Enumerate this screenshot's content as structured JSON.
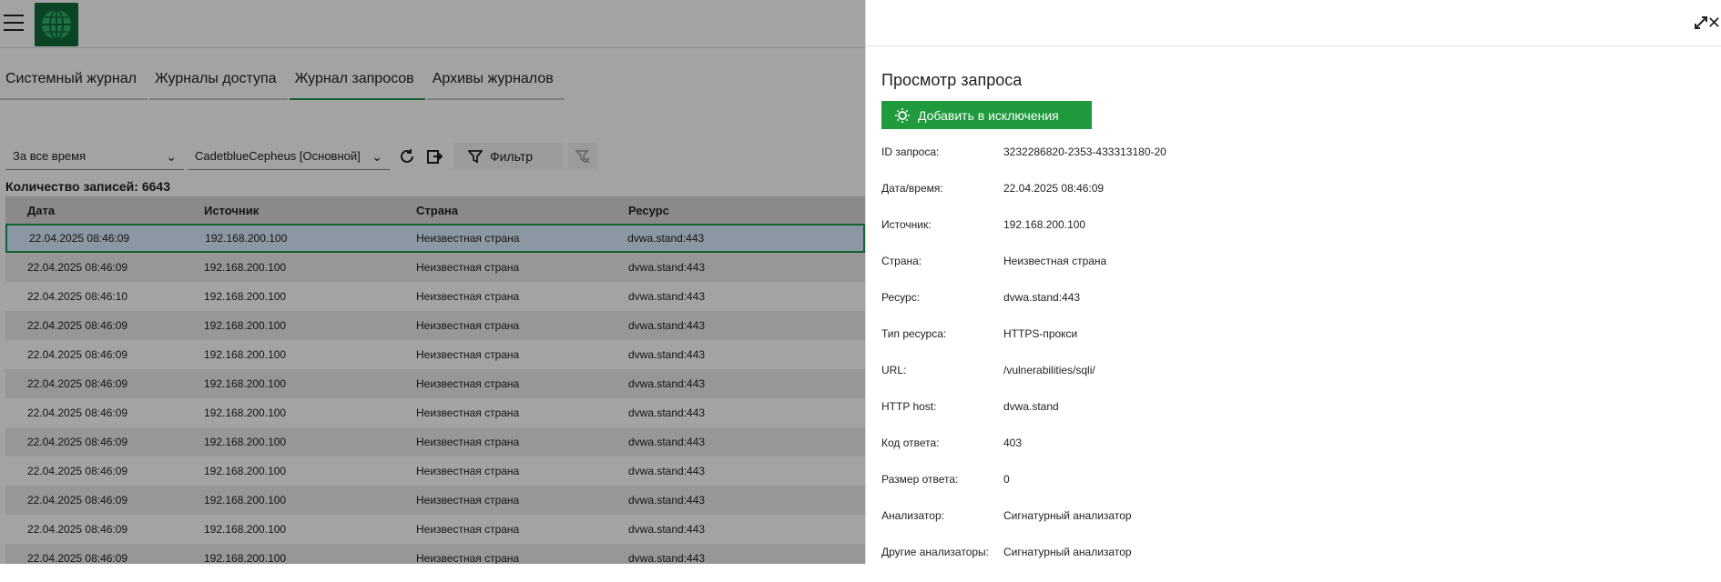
{
  "left": {
    "tabs": [
      {
        "label": "Системный журнал",
        "active": false
      },
      {
        "label": "Журналы доступа",
        "active": false
      },
      {
        "label": "Журнал запросов",
        "active": true
      },
      {
        "label": "Архивы журналов",
        "active": false
      }
    ],
    "filters": {
      "period": "За все время",
      "node": "CadetblueCepheus [Основной]",
      "filter_label": "Фильтр"
    },
    "count_label": "Количество записей: 6643",
    "table": {
      "headers": [
        "Дата",
        "Источник",
        "Страна",
        "Ресурс"
      ],
      "rows": [
        {
          "date": "22.04.2025 08:46:09",
          "source": "192.168.200.100",
          "country": "Неизвестная страна",
          "resource": "dvwa.stand:443",
          "selected": true
        },
        {
          "date": "22.04.2025 08:46:09",
          "source": "192.168.200.100",
          "country": "Неизвестная страна",
          "resource": "dvwa.stand:443"
        },
        {
          "date": "22.04.2025 08:46:10",
          "source": "192.168.200.100",
          "country": "Неизвестная страна",
          "resource": "dvwa.stand:443"
        },
        {
          "date": "22.04.2025 08:46:09",
          "source": "192.168.200.100",
          "country": "Неизвестная страна",
          "resource": "dvwa.stand:443"
        },
        {
          "date": "22.04.2025 08:46:09",
          "source": "192.168.200.100",
          "country": "Неизвестная страна",
          "resource": "dvwa.stand:443"
        },
        {
          "date": "22.04.2025 08:46:09",
          "source": "192.168.200.100",
          "country": "Неизвестная страна",
          "resource": "dvwa.stand:443"
        },
        {
          "date": "22.04.2025 08:46:09",
          "source": "192.168.200.100",
          "country": "Неизвестная страна",
          "resource": "dvwa.stand:443"
        },
        {
          "date": "22.04.2025 08:46:09",
          "source": "192.168.200.100",
          "country": "Неизвестная страна",
          "resource": "dvwa.stand:443"
        },
        {
          "date": "22.04.2025 08:46:09",
          "source": "192.168.200.100",
          "country": "Неизвестная страна",
          "resource": "dvwa.stand:443"
        },
        {
          "date": "22.04.2025 08:46:09",
          "source": "192.168.200.100",
          "country": "Неизвестная страна",
          "resource": "dvwa.stand:443"
        },
        {
          "date": "22.04.2025 08:46:09",
          "source": "192.168.200.100",
          "country": "Неизвестная страна",
          "resource": "dvwa.stand:443"
        },
        {
          "date": "22.04.2025 08:46:09",
          "source": "192.168.200.100",
          "country": "Неизвестная страна",
          "resource": "dvwa.stand:443"
        }
      ]
    }
  },
  "panel": {
    "title": "Просмотр запроса",
    "exclude_button": "Добавить в исключения",
    "fields": [
      {
        "label": "ID запроса:",
        "value": "3232286820-2353-433313180-20"
      },
      {
        "label": "Дата/время:",
        "value": "22.04.2025 08:46:09"
      },
      {
        "label": "Источник:",
        "value": "192.168.200.100"
      },
      {
        "label": "Страна:",
        "value": "Неизвестная страна"
      },
      {
        "label": "Ресурс:",
        "value": "dvwa.stand:443"
      },
      {
        "label": "Тип ресурса:",
        "value": "HTTPS-прокси"
      },
      {
        "label": "URL:",
        "value": "/vulnerabilities/sqli/"
      },
      {
        "label": "HTTP host:",
        "value": "dvwa.stand"
      },
      {
        "label": "Код ответа:",
        "value": "403"
      },
      {
        "label": "Размер ответа:",
        "value": "0"
      },
      {
        "label": "Анализатор:",
        "value": "Сигнатурный анализатор"
      },
      {
        "label": "Другие анализаторы:",
        "value": "Сигнатурный анализатор"
      }
    ]
  },
  "colors": {
    "accent": "#1f9a3c",
    "logo_bg": "#0f6b3a",
    "overlay": "rgba(0,0,0,0.36)"
  },
  "icons": [
    "menu-icon",
    "globe-logo-icon",
    "chevron-down-icon",
    "refresh-icon",
    "export-icon",
    "filter-icon",
    "clear-filter-icon",
    "lightbulb-icon",
    "expand-icon",
    "close-icon"
  ]
}
